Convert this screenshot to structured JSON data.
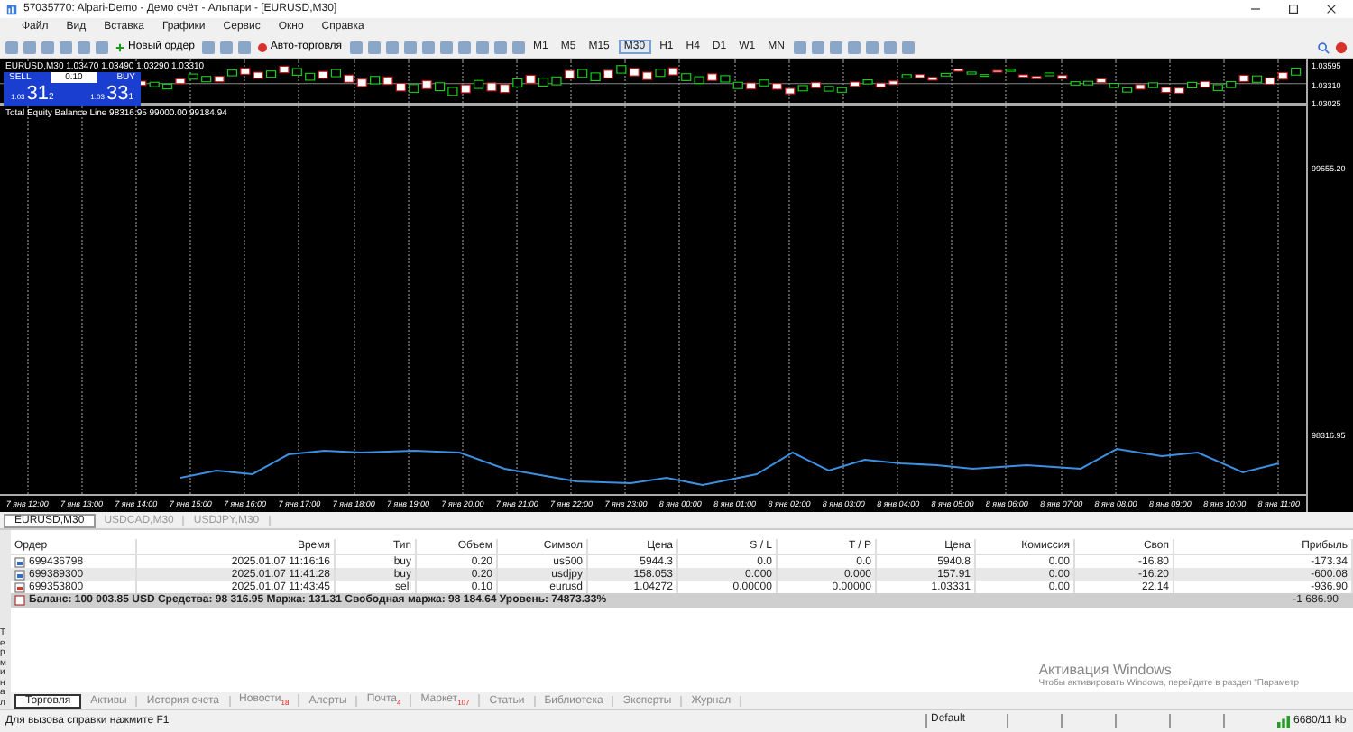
{
  "window": {
    "title": "57035770: Alpari-Demo - Демо счёт - Альпари - [EURUSD,M30]"
  },
  "menu": [
    "Файл",
    "Вид",
    "Вставка",
    "Графики",
    "Сервис",
    "Окно",
    "Справка"
  ],
  "toolbar": {
    "new_order": "Новый ордер",
    "auto_trading": "Авто-торговля",
    "timeframes": [
      {
        "label": "M1",
        "selected": false
      },
      {
        "label": "M5",
        "selected": false
      },
      {
        "label": "M15",
        "selected": false
      },
      {
        "label": "M30",
        "selected": true
      },
      {
        "label": "H1",
        "selected": false
      },
      {
        "label": "H4",
        "selected": false
      },
      {
        "label": "D1",
        "selected": false
      },
      {
        "label": "W1",
        "selected": false
      },
      {
        "label": "MN",
        "selected": false
      }
    ]
  },
  "chart": {
    "header": "EURUSD,M30 1.03470 1.03490 1.03290 1.03310",
    "one_click": {
      "sell": "SELL",
      "buy": "BUY",
      "volume": "0.10",
      "sell_prefix": "1.03",
      "sell_big": "31",
      "sell_sup": "2",
      "buy_prefix": "1.03",
      "buy_big": "33",
      "buy_sup": "1"
    },
    "indicator_label": "Total Equity Balance Line 98316.95 99000.00 99184.94",
    "price_labels": [
      "1.03595",
      "1.03310",
      "1.03025"
    ],
    "indicator_price_labels": [
      "99655.20",
      "98316.95"
    ],
    "time_labels": [
      "7 янв 12:00",
      "7 янв 13:00",
      "7 янв 14:00",
      "7 янв 15:00",
      "7 янв 16:00",
      "7 янв 17:00",
      "7 янв 18:00",
      "7 янв 19:00",
      "7 янв 20:00",
      "7 янв 21:00",
      "7 янв 22:00",
      "7 янв 23:00",
      "8 янв 00:00",
      "8 янв 01:00",
      "8 янв 02:00",
      "8 янв 03:00",
      "8 янв 04:00",
      "8 янв 05:00",
      "8 янв 06:00",
      "8 янв 07:00",
      "8 янв 08:00",
      "8 янв 09:00",
      "8 янв 10:00",
      "8 янв 11:00"
    ]
  },
  "chart_tabs": [
    {
      "label": "EURUSD,M30",
      "selected": true
    },
    {
      "label": "USDCAD,M30",
      "selected": false
    },
    {
      "label": "USDJPY,M30",
      "selected": false
    }
  ],
  "terminal": {
    "side_label": "Терминал",
    "columns": [
      "Ордер",
      "Время",
      "Тип",
      "Объем",
      "Символ",
      "Цена",
      "S / L",
      "T / P",
      "Цена",
      "Комиссия",
      "Своп",
      "Прибыль"
    ],
    "rows": [
      {
        "kind": "buy",
        "cells": [
          "699436798",
          "2025.01.07 11:16:16",
          "buy",
          "0.20",
          "us500",
          "5944.3",
          "0.0",
          "0.0",
          "5940.8",
          "0.00",
          "-16.80",
          "-173.34"
        ]
      },
      {
        "kind": "buy",
        "cells": [
          "699389300",
          "2025.01.07 11:41:28",
          "buy",
          "0.20",
          "usdjpy",
          "158.053",
          "0.000",
          "0.000",
          "157.91",
          "0.00",
          "-16.20",
          "-600.08"
        ]
      },
      {
        "kind": "sell",
        "cells": [
          "699353800",
          "2025.01.07 11:43:45",
          "sell",
          "0.10",
          "eurusd",
          "1.04272",
          "0.00000",
          "0.00000",
          "1.03331",
          "0.00",
          "22.14",
          "-936.90"
        ]
      }
    ],
    "summary": "Баланс: 100 003.85 USD  Средства: 98 316.95  Маржа: 131.31  Свободная маржа: 98 184.64  Уровень: 74873.33%",
    "total": "-1 686.90",
    "tabs": [
      {
        "label": "Торговля",
        "selected": true
      },
      {
        "label": "Активы",
        "selected": false
      },
      {
        "label": "История счета",
        "selected": false
      },
      {
        "label": "Новости",
        "badge": "18",
        "selected": false
      },
      {
        "label": "Алерты",
        "selected": false
      },
      {
        "label": "Почта",
        "badge": "4",
        "selected": false
      },
      {
        "label": "Маркет",
        "badge": "107",
        "selected": false
      },
      {
        "label": "Статьи",
        "selected": false
      },
      {
        "label": "Библиотека",
        "selected": false
      },
      {
        "label": "Эксперты",
        "selected": false
      },
      {
        "label": "Журнал",
        "selected": false
      }
    ]
  },
  "os_overlay": {
    "title": "Активация Windows",
    "text": "Чтобы активировать Windows, перейдите в раздел \"Параметр"
  },
  "status_bar": {
    "hint": "Для вызова справки нажмите F1",
    "profile": "Default",
    "traffic": "6680/11 kb"
  }
}
